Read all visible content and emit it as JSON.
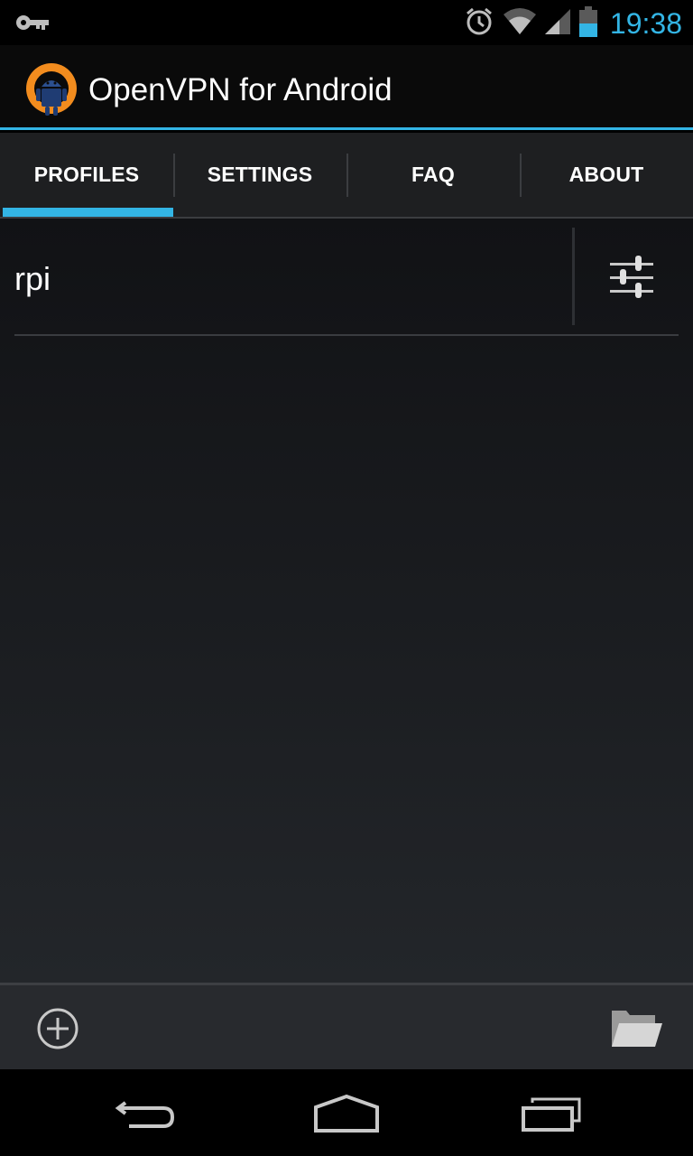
{
  "status_bar": {
    "time": "19:38",
    "icons": [
      "vpn-key-icon",
      "alarm-icon",
      "wifi-icon",
      "signal-icon",
      "battery-icon"
    ]
  },
  "action_bar": {
    "title": "OpenVPN for Android",
    "logo": "openvpn-logo"
  },
  "tabs": [
    {
      "label": "PROFILES",
      "active": true
    },
    {
      "label": "SETTINGS",
      "active": false
    },
    {
      "label": "FAQ",
      "active": false
    },
    {
      "label": "ABOUT",
      "active": false
    }
  ],
  "profiles": [
    {
      "name": "rpi",
      "edit_icon": "sliders-icon"
    }
  ],
  "bottom_bar": {
    "add_icon": "add-circle-icon",
    "import_icon": "folder-open-icon"
  },
  "nav_bar": {
    "icons": [
      "back-icon",
      "home-icon",
      "recent-apps-icon"
    ]
  },
  "colors": {
    "accent": "#33b5e5",
    "logo_orange": "#f28c1e",
    "logo_blue": "#1f3c73"
  }
}
